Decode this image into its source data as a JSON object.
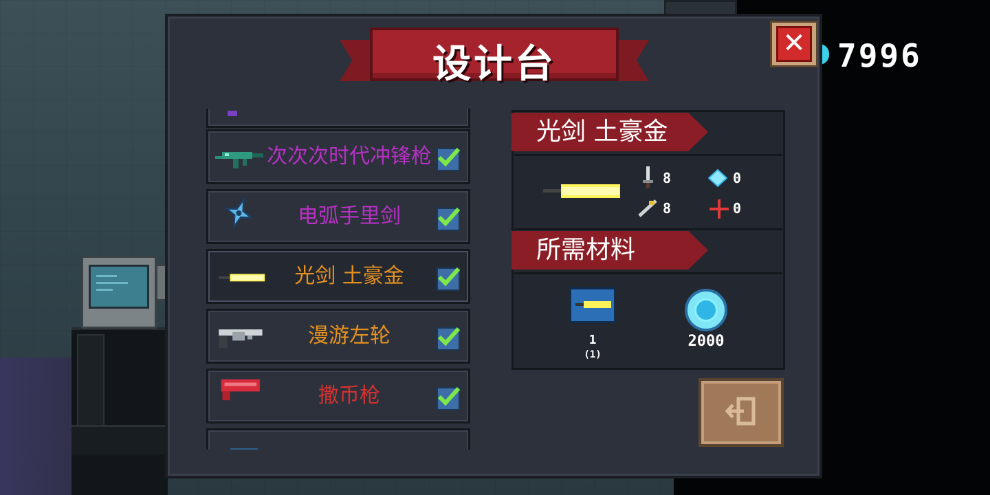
{
  "header": {
    "title": "设计台",
    "coins": "7996"
  },
  "weapon_list": {
    "items": [
      {
        "name": "次次次时代冲锋枪",
        "color": "#b631c4",
        "checked": true
      },
      {
        "name": "电弧手里剑",
        "color": "#b631c4",
        "checked": true
      },
      {
        "name": "光剑 土豪金",
        "color": "#e8921e",
        "checked": true,
        "selected": true
      },
      {
        "name": "漫游左轮",
        "color": "#e8921e",
        "checked": true
      },
      {
        "name": "撒币枪",
        "color": "#d63030",
        "checked": true
      }
    ]
  },
  "detail": {
    "weapon_name": "光剑 土豪金",
    "stats": {
      "damage": "8",
      "energy": "0",
      "critical": "8",
      "inaccuracy": "0"
    },
    "materials_label": "所需材料",
    "materials": [
      {
        "icon": "blueprint-icon",
        "count": "1",
        "owned": "(1)"
      },
      {
        "icon": "gem-icon",
        "count": "2000"
      }
    ]
  },
  "icons": {
    "close": "close-icon",
    "exit": "exit-icon",
    "coin": "gem-coin-icon"
  }
}
